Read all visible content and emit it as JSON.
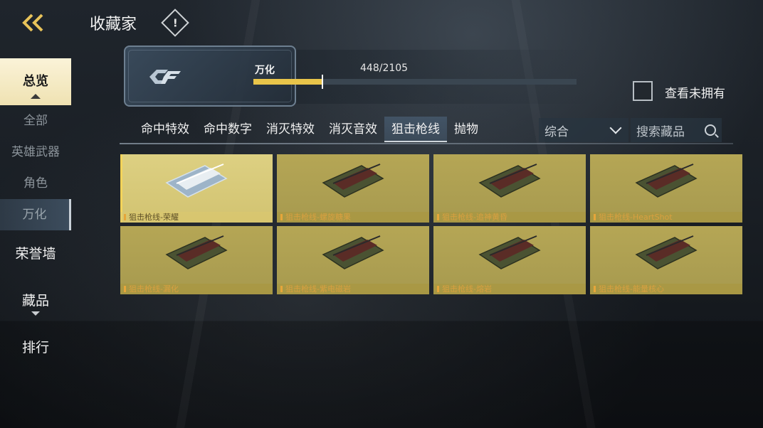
{
  "header": {
    "title": "收藏家",
    "back_icon": "double-chevron-left-icon",
    "info_icon": "warning-diamond-icon"
  },
  "sidebar": {
    "active": "总览",
    "subitems": [
      "全部",
      "英雄武器",
      "角色",
      "万化"
    ],
    "active_sub": "万化",
    "items": [
      "荣誉墙",
      "藏品",
      "排行"
    ]
  },
  "progress": {
    "name": "万化",
    "count_text": "448/2105",
    "current": 448,
    "total": 2105
  },
  "owned_filter": {
    "label": "查看未拥有",
    "checked": false
  },
  "tabs": [
    "命中特效",
    "命中数字",
    "消灭特效",
    "消灭音效",
    "狙击枪线",
    "抛物"
  ],
  "active_tab": "狙击枪线",
  "sort": {
    "value": "综合"
  },
  "search": {
    "placeholder": "搜索藏品"
  },
  "items": [
    {
      "label": "狙击枪线-荣耀",
      "featured": true
    },
    {
      "label": "狙击枪线-螺旋糖果",
      "featured": false
    },
    {
      "label": "狙击枪线-追神黄昏",
      "featured": false
    },
    {
      "label": "狙击枪线-HeartShot",
      "featured": false
    },
    {
      "label": "狙击枪线-漏化",
      "featured": false
    },
    {
      "label": "狙击枪线-紫电磁岩",
      "featured": false
    },
    {
      "label": "狙击枪线-熔岩",
      "featured": false
    },
    {
      "label": "狙击枪线-能量核心",
      "featured": false
    }
  ],
  "colors": {
    "accent": "#e9c54a",
    "card": "#b5a655",
    "card_featured": "#ddd082"
  }
}
